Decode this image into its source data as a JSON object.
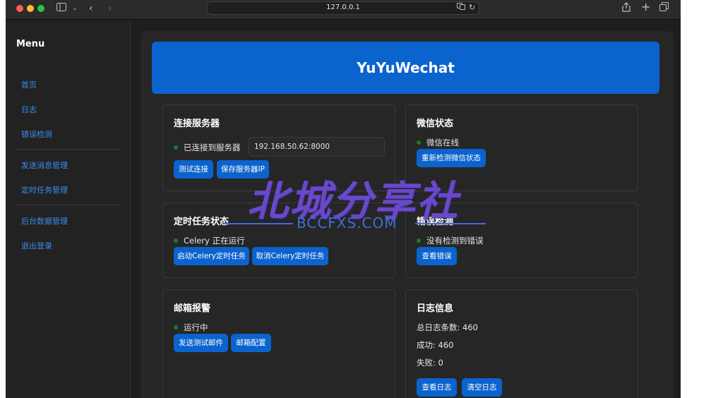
{
  "browser": {
    "url": "127.0.0.1"
  },
  "sidebar": {
    "title": "Menu",
    "items": [
      {
        "label": "首页"
      },
      {
        "label": "日志"
      },
      {
        "label": "错误检测"
      },
      {
        "label": "发送消息管理"
      },
      {
        "label": "定时任务管理"
      },
      {
        "label": "后台数据管理"
      },
      {
        "label": "退出登录"
      }
    ]
  },
  "header": {
    "title": "YuYuWechat"
  },
  "server_card": {
    "title": "连接服务器",
    "status": "已连接到服务器",
    "address_value": "192.168.50.62:8000",
    "test_button": "测试连接",
    "save_button": "保存服务器IP"
  },
  "wechat_card": {
    "title": "微信状态",
    "status": "微信在线",
    "recheck_button": "重新检测微信状态"
  },
  "task_card": {
    "title": "定时任务状态",
    "status": "Celery 正在运行",
    "start_button": "启动Celery定时任务",
    "cancel_button": "取消Celery定时任务"
  },
  "error_card": {
    "title": "错误检测",
    "status": "没有检测到错误",
    "view_button": "查看错误"
  },
  "mail_card": {
    "title": "邮箱报警",
    "status": "运行中",
    "send_test_button": "发送测试邮件",
    "config_button": "邮箱配置"
  },
  "log_card": {
    "title": "日志信息",
    "total": "总日志条数: 460",
    "success": "成功: 460",
    "fail": "失败: 0",
    "view_button": "查看日志",
    "clear_button": "清空日志"
  },
  "watermark": {
    "big": "北城分享社",
    "small": "BCCFXS.COM"
  },
  "colors": {
    "accent": "#0b63ce",
    "status_dot": "#1d7a2a",
    "link": "#3a8df0"
  }
}
